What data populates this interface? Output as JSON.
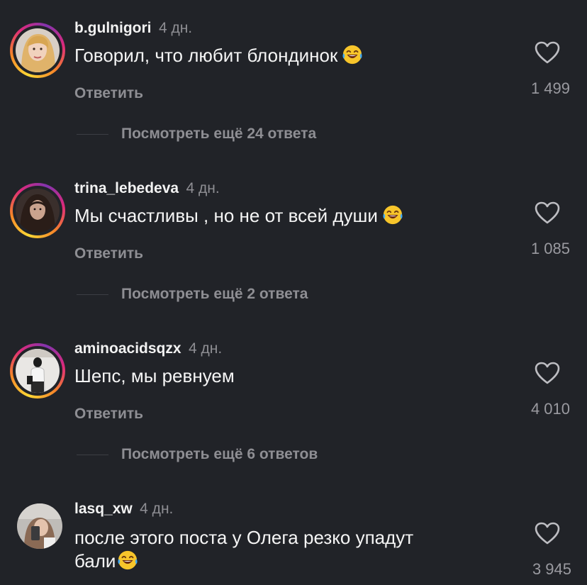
{
  "comments": [
    {
      "username": "b.gulnigori",
      "time": "4 дн.",
      "text": "Говорил, что любит блондинок",
      "emoji": "face-with-tears-of-joy",
      "reply_label": "Ответить",
      "likes": "1 499",
      "more_replies": "Посмотреть ещё 24 ответа",
      "story_ring": true
    },
    {
      "username": "trina_lebedeva",
      "time": "4 дн.",
      "text": "Мы счастливы , но не от всей души",
      "emoji": "face-with-tears-of-joy",
      "reply_label": "Ответить",
      "likes": "1 085",
      "more_replies": "Посмотреть ещё 2 ответа",
      "story_ring": true
    },
    {
      "username": "aminoacidsqzx",
      "time": "4 дн.",
      "text": "Шепс, мы ревнуем",
      "reply_label": "Ответить",
      "likes": "4 010",
      "more_replies": "Посмотреть ещё 6 ответов",
      "story_ring": true
    },
    {
      "username": "lasq_xw",
      "time": "4 дн.",
      "text_line1": "после этого поста у Олега резко упадут",
      "text_line2": "бали",
      "emoji": "face-with-tears-of-joy",
      "likes": "3 945",
      "story_ring": false
    }
  ],
  "colors": {
    "background": "#212328",
    "username": "#f2f2f2",
    "muted": "#8e8e93",
    "story_ring": [
      "#fdd835",
      "#f58529",
      "#dd2a7b",
      "#8134af"
    ]
  },
  "icons": {
    "like": "heart-outline-icon",
    "emoji": "face-with-tears-of-joy-emoji"
  }
}
